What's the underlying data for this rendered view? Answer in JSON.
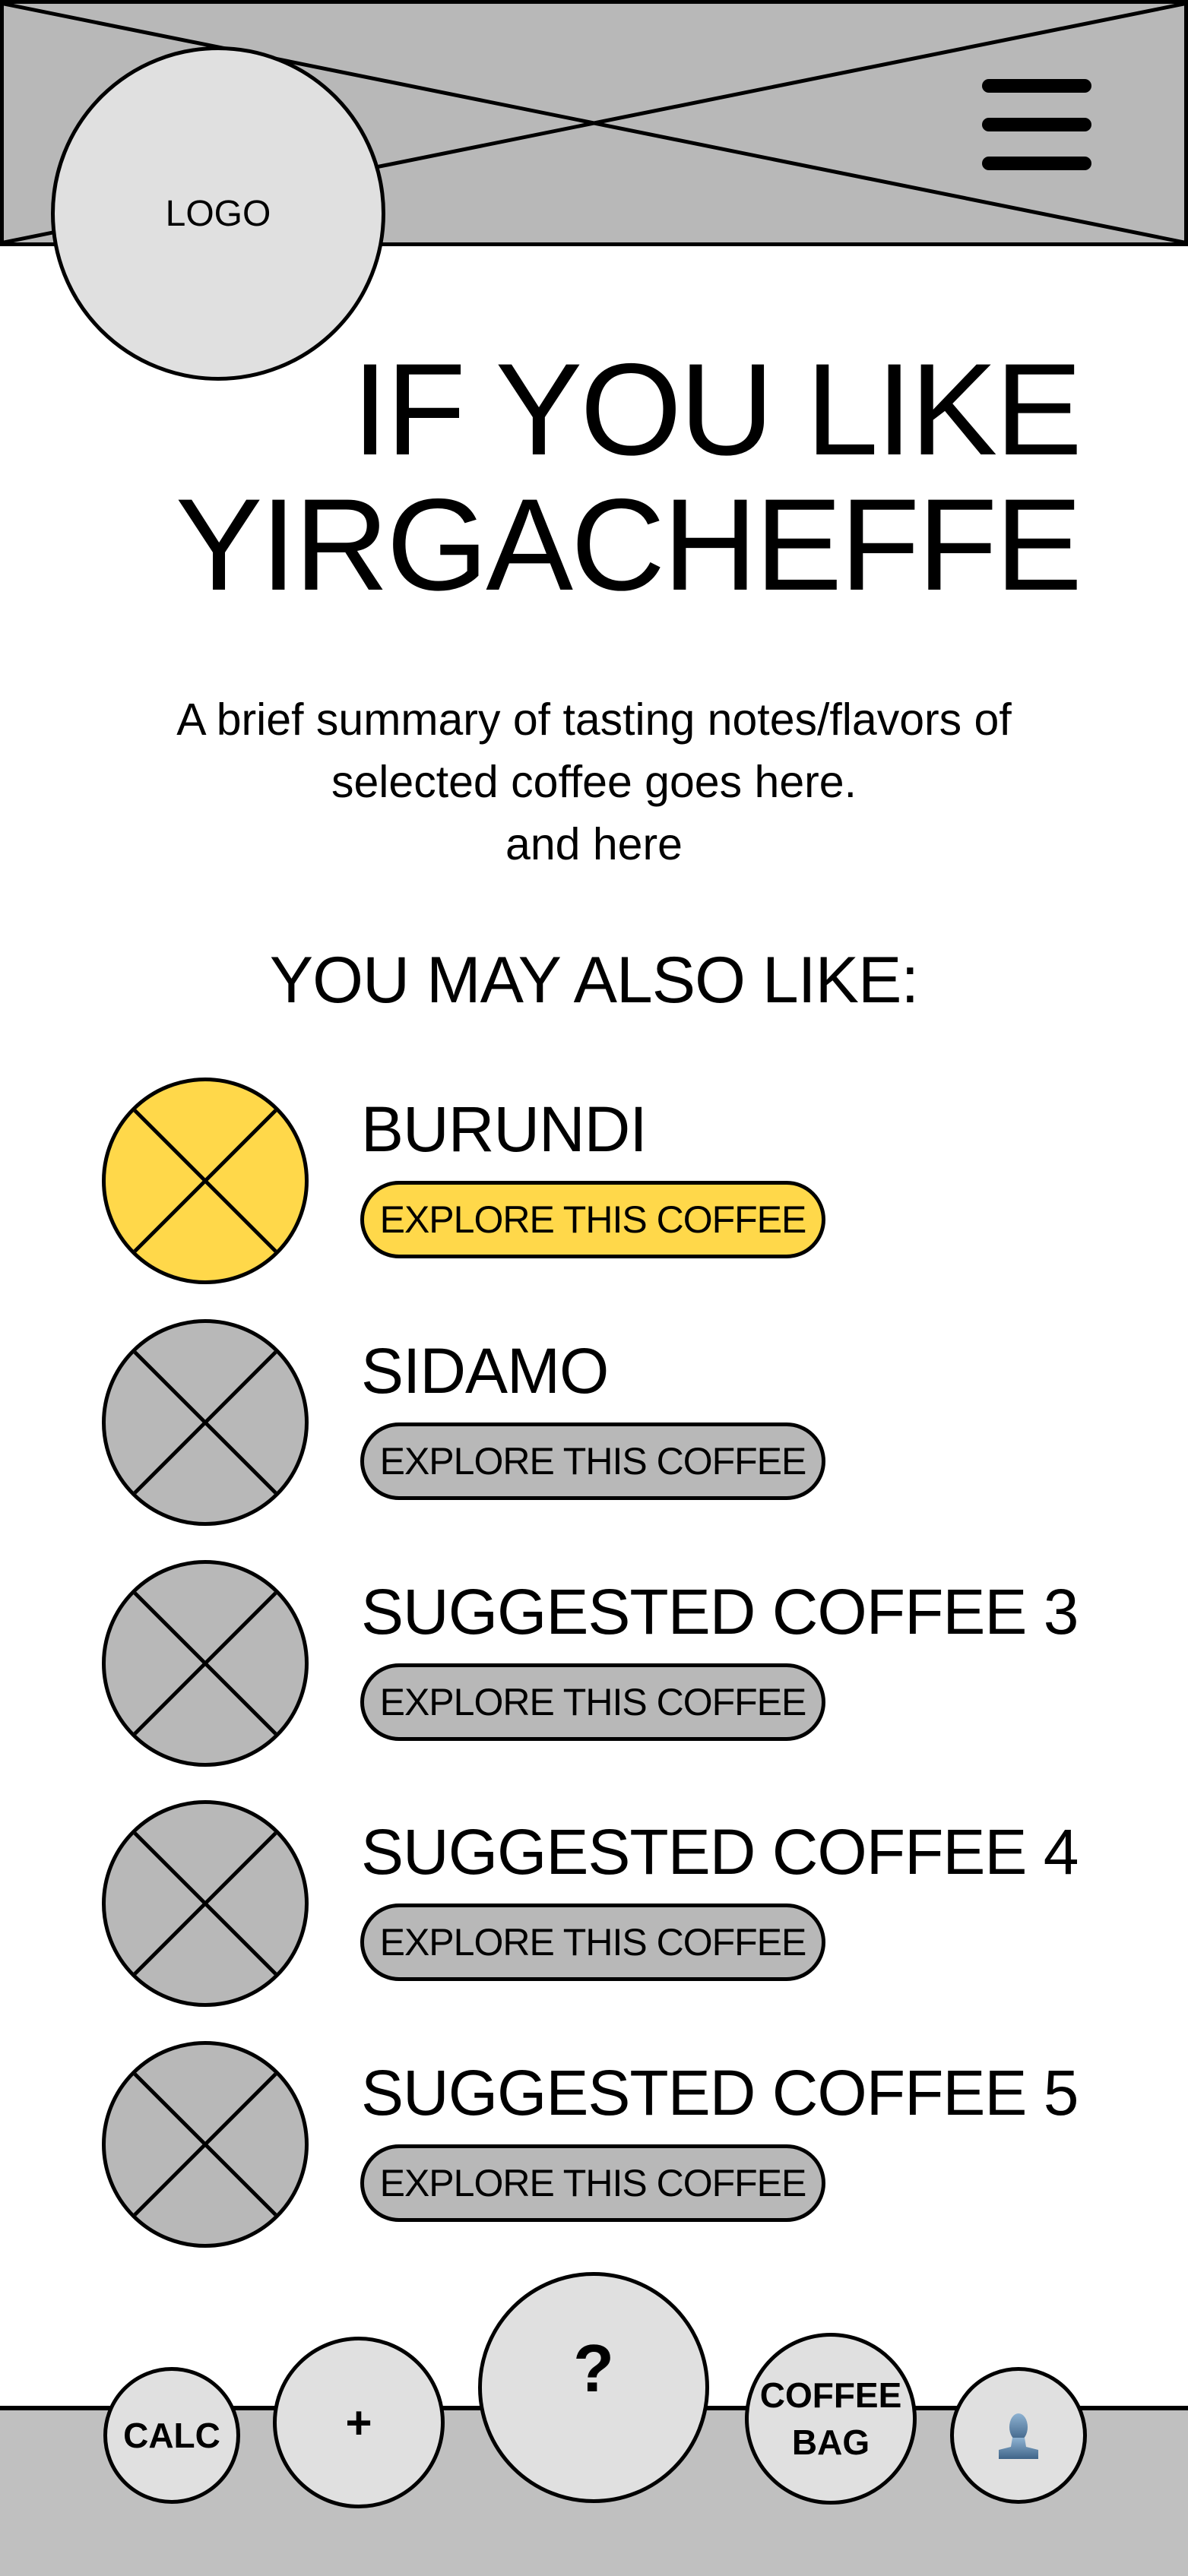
{
  "header": {
    "logo_label": "LOGO",
    "menu_icon": "hamburger-menu-icon"
  },
  "main": {
    "title_line1": "IF YOU LIKE",
    "title_line2": "YIRGACHEFFE",
    "summary_line1": "A brief summary of tasting notes/flavors of",
    "summary_line2": "selected coffee goes here.",
    "summary_line3": "and here",
    "also_like_heading": "YOU MAY ALSO LIKE:"
  },
  "suggestions": [
    {
      "name": "BURUNDI",
      "button_label": "EXPLORE THIS COFFEE",
      "highlighted": true
    },
    {
      "name": "SIDAMO",
      "button_label": "EXPLORE THIS COFFEE",
      "highlighted": false
    },
    {
      "name": "SUGGESTED COFFEE 3",
      "button_label": "EXPLORE THIS COFFEE",
      "highlighted": false
    },
    {
      "name": "SUGGESTED COFFEE 4",
      "button_label": "EXPLORE THIS COFFEE",
      "highlighted": false
    },
    {
      "name": "SUGGESTED COFFEE 5",
      "button_label": "EXPLORE THIS COFFEE",
      "highlighted": false
    }
  ],
  "bottom_nav": {
    "calc": "CALC",
    "add": "+",
    "help": "?",
    "coffee_bag_line1": "COFFEE",
    "coffee_bag_line2": "BAG",
    "profile_icon": "user-profile-icon"
  },
  "colors": {
    "highlight": "#ffd84a",
    "placeholder": "#b8b8b8",
    "nav_fill": "#e0e0e0",
    "bar": "#c0c0c0"
  }
}
